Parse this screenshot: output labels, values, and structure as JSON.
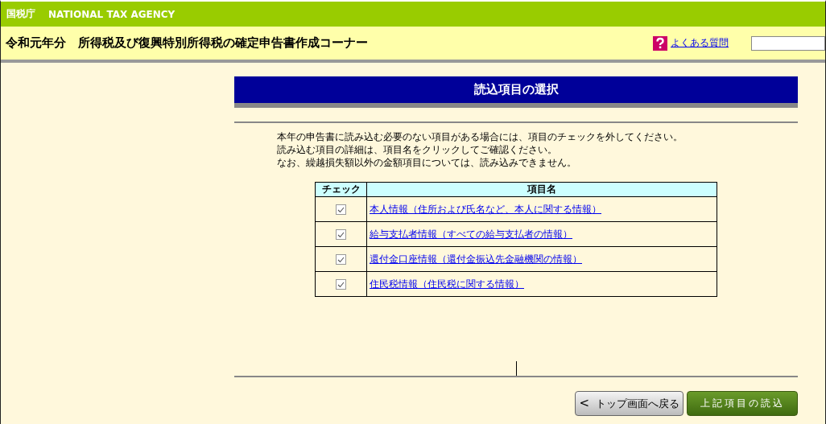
{
  "agency_bar": {
    "name_ja": "国税庁",
    "name_en": "NATIONAL TAX AGENCY"
  },
  "header": {
    "title": "令和元年分　所得税及び復興特別所得税の確定申告書作成コーナー",
    "faq_link": "よくある質問"
  },
  "section_title": "読込項目の選択",
  "instructions": [
    "本年の申告書に読み込む必要のない項目がある場合には、項目のチェックを外してください。",
    "読み込む項目の詳細は、項目名をクリックしてご確認ください。",
    "なお、繰越損失額以外の金額項目については、読み込みできません。"
  ],
  "table": {
    "columns": [
      "チェック",
      "項目名"
    ],
    "rows": [
      {
        "checked": true,
        "name": "本人情報（住所および氏名など、本人に関する情報）"
      },
      {
        "checked": true,
        "name": "給与支払者情報（すべての給与支払者の情報）"
      },
      {
        "checked": true,
        "name": "還付金口座情報（還付金振込先金融機関の情報）"
      },
      {
        "checked": true,
        "name": "住民税情報（住民税に関する情報）"
      }
    ]
  },
  "buttons": {
    "back": {
      "icon": "<",
      "label": "トップ画面へ戻る"
    },
    "load": {
      "label": "上記項目の読込"
    }
  }
}
